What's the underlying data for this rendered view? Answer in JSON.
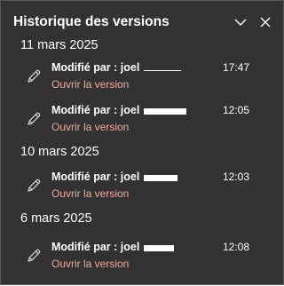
{
  "header": {
    "title": "Historique des versions"
  },
  "groups": [
    {
      "date": "11 mars 2025",
      "entries": [
        {
          "modified": "Modifié par : joel",
          "time": "17:47",
          "open_label": "Ouvrir la version"
        },
        {
          "modified": "Modifié par : joel",
          "time": "12:05",
          "open_label": "Ouvrir la version"
        }
      ]
    },
    {
      "date": "10 mars 2025",
      "entries": [
        {
          "modified": "Modifié par : joel",
          "time": "12:03",
          "open_label": "Ouvrir la version"
        }
      ]
    },
    {
      "date": "6 mars 2025",
      "entries": [
        {
          "modified": "Modifié par : joel",
          "time": "12:08",
          "open_label": "Ouvrir la version"
        }
      ]
    }
  ],
  "colors": {
    "panel_background": "#323232",
    "link": "#f0a899",
    "text": "#ffffff"
  },
  "icons": [
    "chevron-down-icon",
    "close-icon",
    "pencil-icon"
  ]
}
